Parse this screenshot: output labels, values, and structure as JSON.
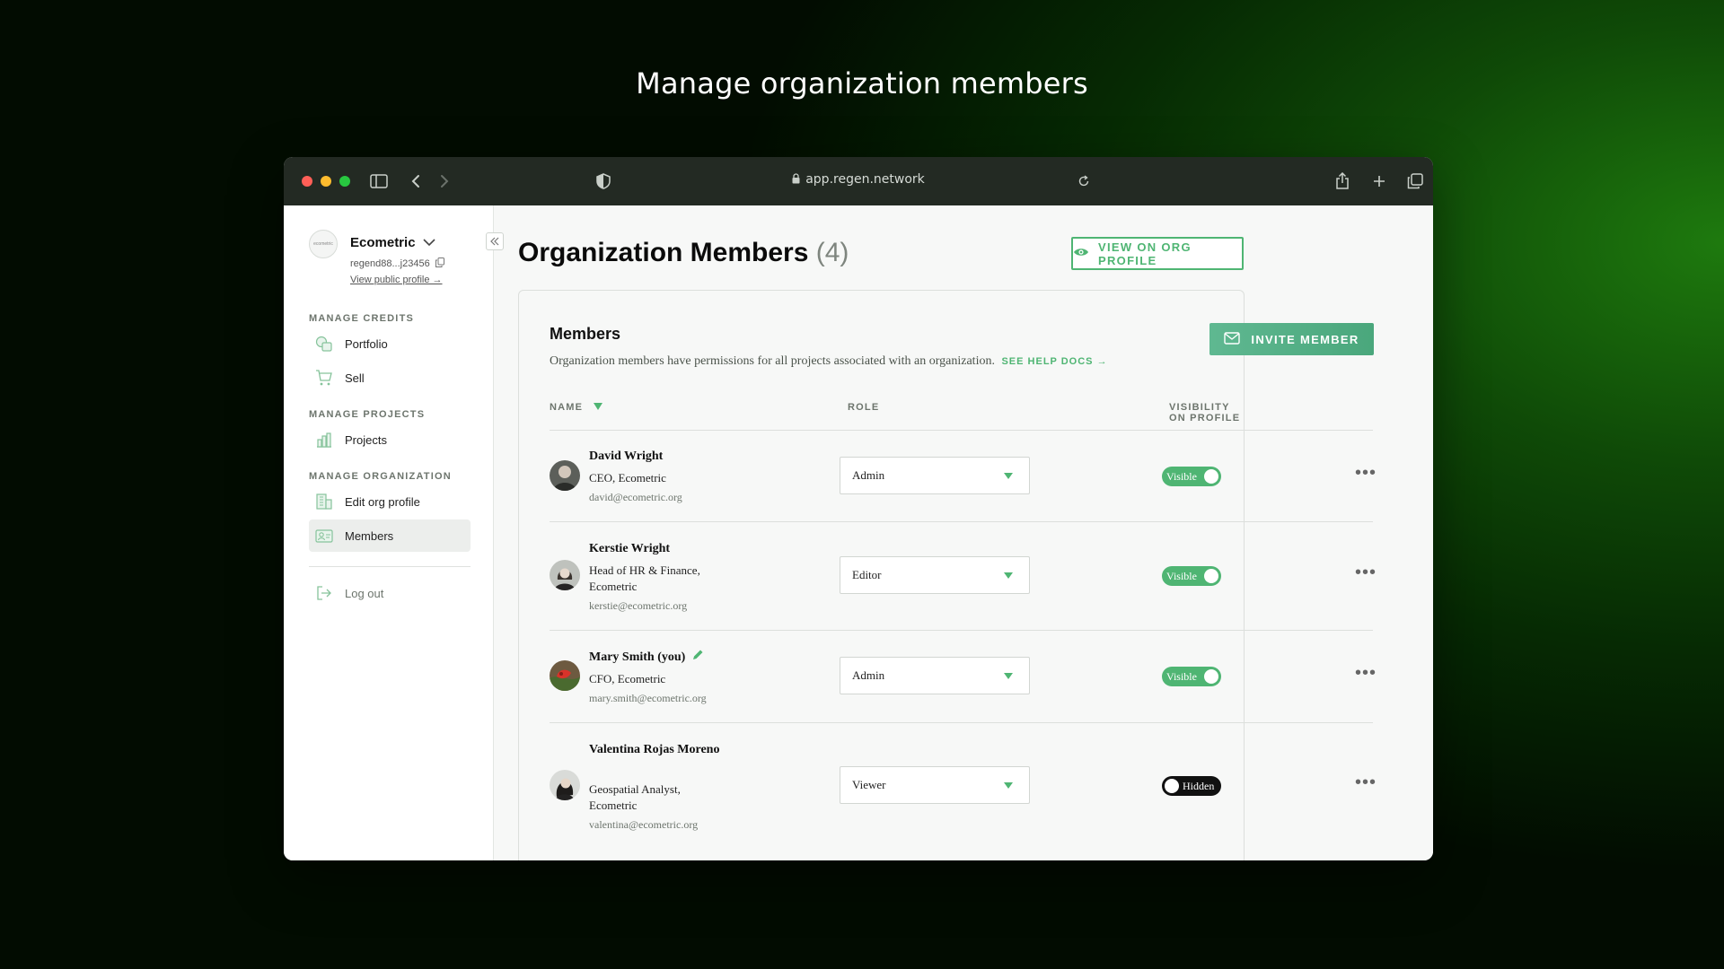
{
  "headline": "Manage organization members",
  "browser": {
    "url": "app.regen.network"
  },
  "colors": {
    "accent": "#4fb573",
    "window_bar": "#232a23"
  },
  "sidebar": {
    "org_name": "Ecometric",
    "org_logo_text": "ecometric",
    "org_address": "regend88...j23456",
    "view_public_profile": "View public profile →",
    "sections": [
      {
        "label": "MANAGE CREDITS",
        "items": [
          {
            "label": "Portfolio",
            "icon": "portfolio-icon"
          },
          {
            "label": "Sell",
            "icon": "cart-icon"
          }
        ]
      },
      {
        "label": "MANAGE PROJECTS",
        "items": [
          {
            "label": "Projects",
            "icon": "projects-icon"
          }
        ]
      },
      {
        "label": "MANAGE ORGANIZATION",
        "items": [
          {
            "label": "Edit org profile",
            "icon": "building-icon"
          },
          {
            "label": "Members",
            "icon": "members-icon",
            "active": true
          }
        ]
      }
    ],
    "logout": "Log out"
  },
  "main": {
    "title": "Organization Members",
    "count": "(4)",
    "view_profile_button": "VIEW ON ORG PROFILE",
    "card": {
      "title": "Members",
      "description": "Organization members have permissions for all projects associated with an organization.",
      "help_link": "SEE HELP DOCS →",
      "invite_button": "INVITE MEMBER",
      "columns": {
        "name": "NAME",
        "role": "ROLE",
        "visibility": "VISIBILITY ON PROFILE"
      }
    },
    "members": [
      {
        "name": "David Wright",
        "title": "CEO, Ecometric",
        "email": "david@ecometric.org",
        "role": "Admin",
        "visibility": "Visible"
      },
      {
        "name": "Kerstie Wright",
        "title": "Head of HR & Finance, Ecometric",
        "email": "kerstie@ecometric.org",
        "role": "Editor",
        "visibility": "Visible"
      },
      {
        "name": "Mary Smith (you)",
        "title": "CFO, Ecometric",
        "email": "mary.smith@ecometric.org",
        "role": "Admin",
        "visibility": "Visible"
      },
      {
        "name": "Valentina Rojas Moreno",
        "title": "Geospatial Analyst, Ecometric",
        "email": "valentina@ecometric.org",
        "role": "Viewer",
        "visibility": "Hidden"
      }
    ]
  }
}
